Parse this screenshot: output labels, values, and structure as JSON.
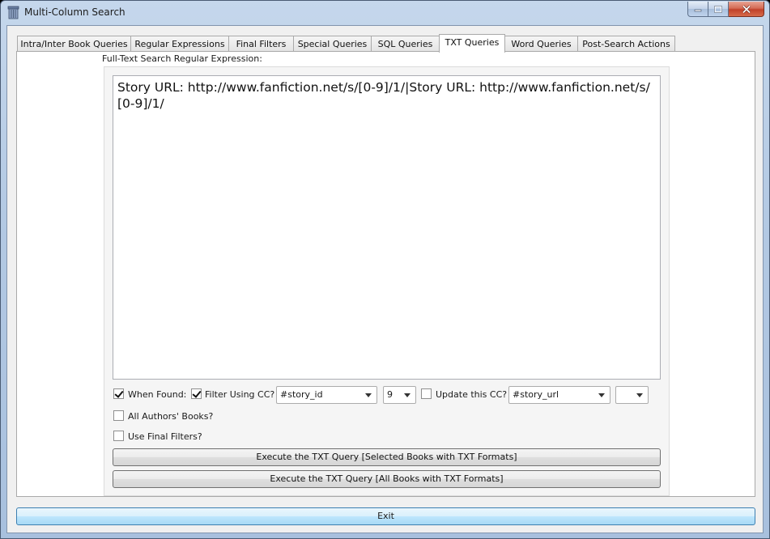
{
  "window": {
    "title": "Multi-Column Search"
  },
  "tabs": [
    {
      "label": "Intra/Inter Book Queries"
    },
    {
      "label": "Regular Expressions"
    },
    {
      "label": "Final Filters"
    },
    {
      "label": "Special Queries"
    },
    {
      "label": "SQL Queries"
    },
    {
      "label": "TXT Queries"
    },
    {
      "label": "Word Queries"
    },
    {
      "label": "Post-Search Actions"
    }
  ],
  "active_tab": "TXT Queries",
  "txt": {
    "field_label": "Full-Text Search Regular Expression:",
    "regex_value": "Story URL: http://www.fanfiction.net/s/[0-9]/1/|Story URL: http://www.fanfiction.net/s/[0-9]/1/",
    "when_found_label": "When Found:",
    "when_found_checked": true,
    "filter_cc_label": "Filter Using CC?",
    "filter_cc_checked": true,
    "filter_cc_combo": "#story_id",
    "filter_num_combo": "9",
    "update_cc_label": "Update this CC?",
    "update_cc_checked": false,
    "update_cc_combo": "#story_url",
    "update_extra_combo": "",
    "all_authors_label": "All Authors' Books?",
    "all_authors_checked": false,
    "final_filters_label": "Use Final Filters?",
    "final_filters_checked": false,
    "exec_selected_label": "Execute the TXT Query [Selected Books with TXT Formats]",
    "exec_all_label": "Execute the TXT Query [All Books with TXT Formats]"
  },
  "footer": {
    "exit_label": "Exit"
  },
  "colors": {
    "title_bar": "#b9cde6",
    "close_button": "#c94a32",
    "exit_button": "#bee6fd"
  }
}
